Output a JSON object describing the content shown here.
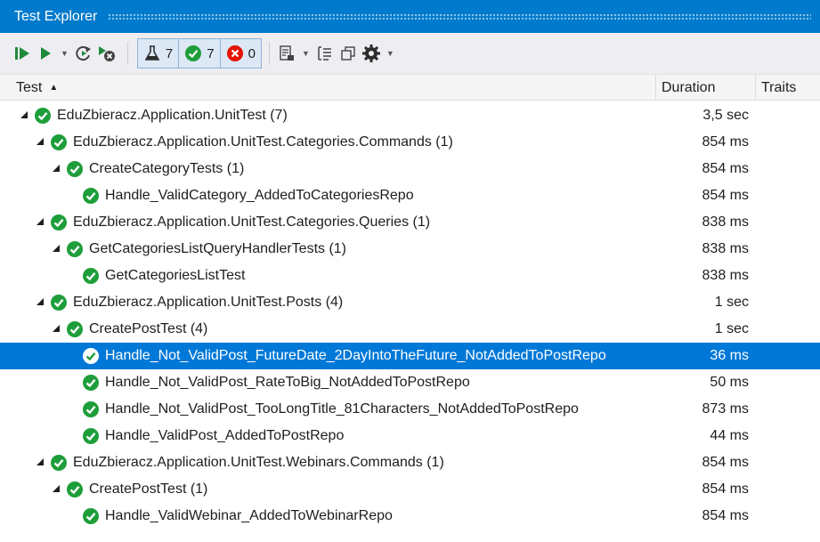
{
  "window": {
    "title": "Test Explorer"
  },
  "toolbar": {
    "run_all_icon": "run-all-icon",
    "run_icon": "play-icon",
    "refresh_icon": "refresh-icon",
    "cancel_icon": "cancel-run-icon",
    "filters": [
      {
        "icon": "flask-icon",
        "count": "7"
      },
      {
        "icon": "passed-check-icon",
        "count": "7"
      },
      {
        "icon": "failed-x-icon",
        "count": "0"
      }
    ]
  },
  "columns": {
    "test": "Test",
    "duration": "Duration",
    "traits": "Traits"
  },
  "rows": [
    {
      "level": 0,
      "expandable": true,
      "name": "EduZbieracz.Application.UnitTest (7)",
      "duration": "3,5 sec",
      "selected": false
    },
    {
      "level": 1,
      "expandable": true,
      "name": "EduZbieracz.Application.UnitTest.Categories.Commands (1)",
      "duration": "854 ms",
      "selected": false
    },
    {
      "level": 2,
      "expandable": true,
      "name": "CreateCategoryTests (1)",
      "duration": "854 ms",
      "selected": false
    },
    {
      "level": 3,
      "expandable": false,
      "name": "Handle_ValidCategory_AddedToCategoriesRepo",
      "duration": "854 ms",
      "selected": false
    },
    {
      "level": 1,
      "expandable": true,
      "name": "EduZbieracz.Application.UnitTest.Categories.Queries (1)",
      "duration": "838 ms",
      "selected": false
    },
    {
      "level": 2,
      "expandable": true,
      "name": "GetCategoriesListQueryHandlerTests (1)",
      "duration": "838 ms",
      "selected": false
    },
    {
      "level": 3,
      "expandable": false,
      "name": "GetCategoriesListTest",
      "duration": "838 ms",
      "selected": false
    },
    {
      "level": 1,
      "expandable": true,
      "name": "EduZbieracz.Application.UnitTest.Posts (4)",
      "duration": "1 sec",
      "selected": false
    },
    {
      "level": 2,
      "expandable": true,
      "name": "CreatePostTest (4)",
      "duration": "1 sec",
      "selected": false
    },
    {
      "level": 3,
      "expandable": false,
      "name": "Handle_Not_ValidPost_FutureDate_2DayIntoTheFuture_NotAddedToPostRepo",
      "duration": "36 ms",
      "selected": true
    },
    {
      "level": 3,
      "expandable": false,
      "name": "Handle_Not_ValidPost_RateToBig_NotAddedToPostRepo",
      "duration": "50 ms",
      "selected": false
    },
    {
      "level": 3,
      "expandable": false,
      "name": "Handle_Not_ValidPost_TooLongTitle_81Characters_NotAddedToPostRepo",
      "duration": "873 ms",
      "selected": false
    },
    {
      "level": 3,
      "expandable": false,
      "name": "Handle_ValidPost_AddedToPostRepo",
      "duration": "44 ms",
      "selected": false
    },
    {
      "level": 1,
      "expandable": true,
      "name": "EduZbieracz.Application.UnitTest.Webinars.Commands (1)",
      "duration": "854 ms",
      "selected": false
    },
    {
      "level": 2,
      "expandable": true,
      "name": "CreatePostTest (1)",
      "duration": "854 ms",
      "selected": false
    },
    {
      "level": 3,
      "expandable": false,
      "name": "Handle_ValidWebinar_AddedToWebinarRepo",
      "duration": "854 ms",
      "selected": false
    }
  ],
  "colors": {
    "accent": "#007acc",
    "selection": "#0078d7",
    "passed": "#1e9e3a",
    "failed": "#e51400"
  }
}
